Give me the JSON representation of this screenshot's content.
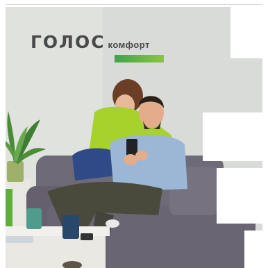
{
  "brand": {
    "name": "ГОЛОС",
    "suffix": "комфорт",
    "accent_color": "#6cbf3c"
  },
  "photo": {
    "icon": "couple-on-sofa-with-phone"
  }
}
